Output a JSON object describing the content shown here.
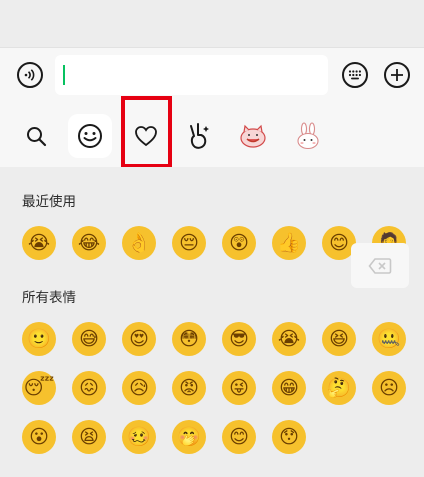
{
  "chat_input": {
    "value": ""
  },
  "icons": {
    "voice": "voice-icon",
    "keyboard": "keyboard-icon",
    "add": "add-icon",
    "search": "search-icon",
    "emoji_tab": "smiley-icon",
    "favorites_tab": "heart-icon",
    "sticker_tab": "victory-hand-sticker-icon",
    "sticker_pack_1": "cat-sticker-icon",
    "sticker_pack_2": "rabbit-sticker-icon",
    "backspace": "backspace-icon"
  },
  "sections": {
    "recent_title": "最近使用",
    "all_title": "所有表情"
  },
  "recent_emojis": [
    "😭",
    "😂",
    "👌",
    "😔",
    "😲",
    "👍",
    "😊",
    "🤦"
  ],
  "all_emojis_row1": [
    "🙂",
    "😅",
    "😍",
    "😳",
    "😎",
    "😭",
    "😆",
    "🤐"
  ],
  "all_emojis_row2": [
    "😴",
    "😖",
    "😥",
    "😡",
    "😜",
    "😁",
    "🤔",
    "☹"
  ],
  "all_emojis_row3": [
    "😮",
    "😫",
    "🥴",
    "🤭",
    "😊",
    "😯"
  ],
  "colors": {
    "accent": "#07c160",
    "highlight": "#e60012",
    "emoji_face": "#f6c12d"
  }
}
